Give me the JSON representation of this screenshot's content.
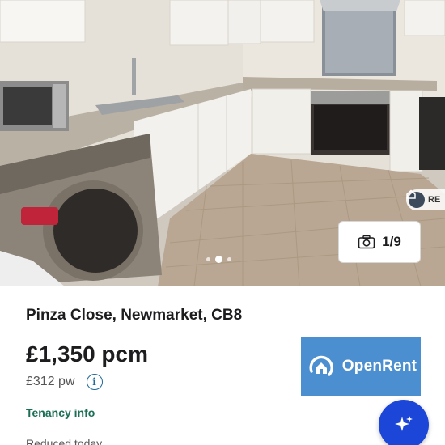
{
  "gallery": {
    "photo_counter": "1/9",
    "camera_icon": "camera-icon",
    "corner_badge_text": "RE",
    "dots_count": 3
  },
  "listing": {
    "address": "Pinza Close, Newmarket, CB8",
    "price_monthly": "£1,350 pcm",
    "price_weekly": "£312 pw",
    "tenancy_link": "Tenancy info",
    "reduced_note": "Reduced today"
  },
  "agent": {
    "logo_text": "OpenRent",
    "logo_color": "#4b8fd0"
  },
  "fab": {
    "icon": "sparkle-icon",
    "color": "#1b46d8"
  },
  "colors": {
    "tenancy_link": "#1a6f55",
    "info_icon": "#1d6a9a"
  }
}
